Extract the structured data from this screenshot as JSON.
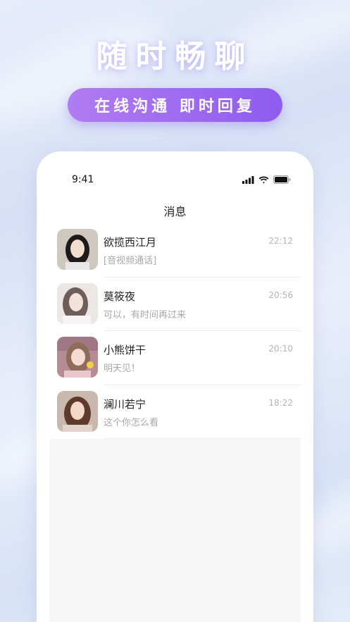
{
  "promo": {
    "headline": "随时畅聊",
    "tagline": "在线沟通 即时回复"
  },
  "status_bar": {
    "time": "9:41",
    "icons": [
      "signal-icon",
      "wifi-icon",
      "battery-icon"
    ]
  },
  "screen": {
    "title": "消息"
  },
  "conversations": [
    {
      "name": "欲揽西江月",
      "message": "[音视频通话]",
      "time": "22:12"
    },
    {
      "name": "莫筱夜",
      "message": "可以，有时间再过来",
      "time": "20:56"
    },
    {
      "name": "小熊饼干",
      "message": "明天见！",
      "time": "20:10"
    },
    {
      "name": "澜川若宁",
      "message": "这个你怎么看",
      "time": "18:22"
    }
  ],
  "colors": {
    "accent_start": "#b07cf2",
    "accent_end": "#8f5bef",
    "background": "#dfe6f8"
  }
}
